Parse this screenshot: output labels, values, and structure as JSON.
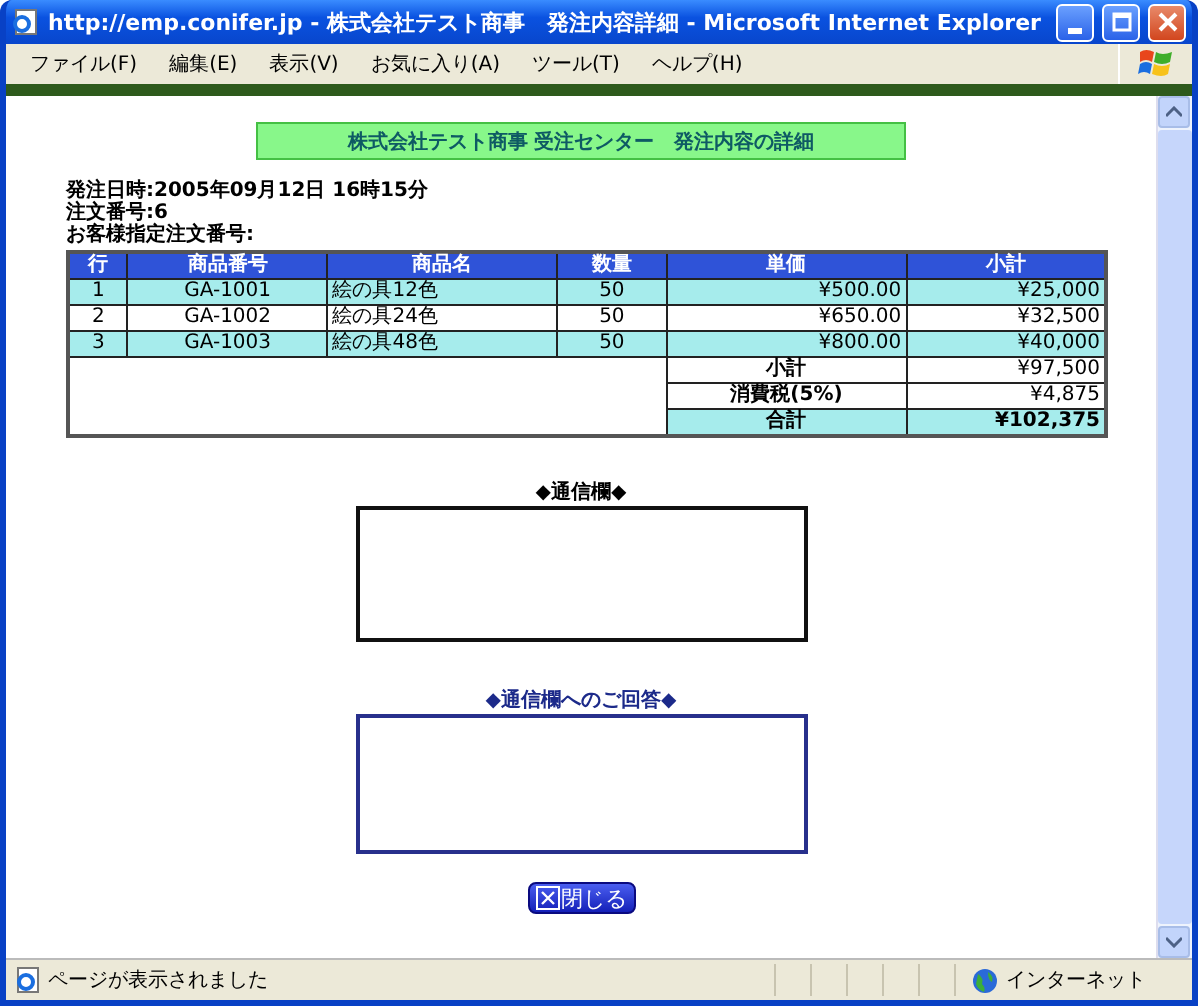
{
  "window": {
    "title": "http://emp.conifer.jp - 株式会社テスト商事　発注内容詳細 - Microsoft Internet Explorer"
  },
  "menu": [
    "ファイル(F)",
    "編集(E)",
    "表示(V)",
    "お気に入り(A)",
    "ツール(T)",
    "ヘルプ(H)"
  ],
  "page": {
    "heading": "株式会社テスト商事 受注センター　発注内容の詳細",
    "info": [
      "発注日時:2005年09月12日 16時15分",
      "注文番号:6",
      "お客様指定注文番号:"
    ],
    "table": {
      "columns": [
        "行",
        "商品番号",
        "商品名",
        "数量",
        "単価",
        "小計"
      ],
      "rows": [
        {
          "cells": [
            "1",
            "GA-1001",
            "絵の具12色",
            "50",
            "¥500.00",
            "¥25,000"
          ]
        },
        {
          "cells": [
            "2",
            "GA-1002",
            "絵の具24色",
            "50",
            "¥650.00",
            "¥32,500"
          ]
        },
        {
          "cells": [
            "3",
            "GA-1003",
            "絵の具48色",
            "50",
            "¥800.00",
            "¥40,000"
          ]
        }
      ],
      "summary": [
        {
          "kind": "subtotal",
          "label": "小計",
          "value": "¥97,500"
        },
        {
          "kind": "tax",
          "label": "消費税(5%)",
          "value": "¥4,875"
        },
        {
          "kind": "total",
          "label": "合計",
          "value": "¥102,375"
        }
      ]
    },
    "message_label": "◆通信欄◆",
    "reply_label": "◆通信欄へのご回答◆",
    "close_button": "閉じる"
  },
  "status_bar": {
    "text": "ページが表示されました",
    "zone": "インターネット"
  }
}
